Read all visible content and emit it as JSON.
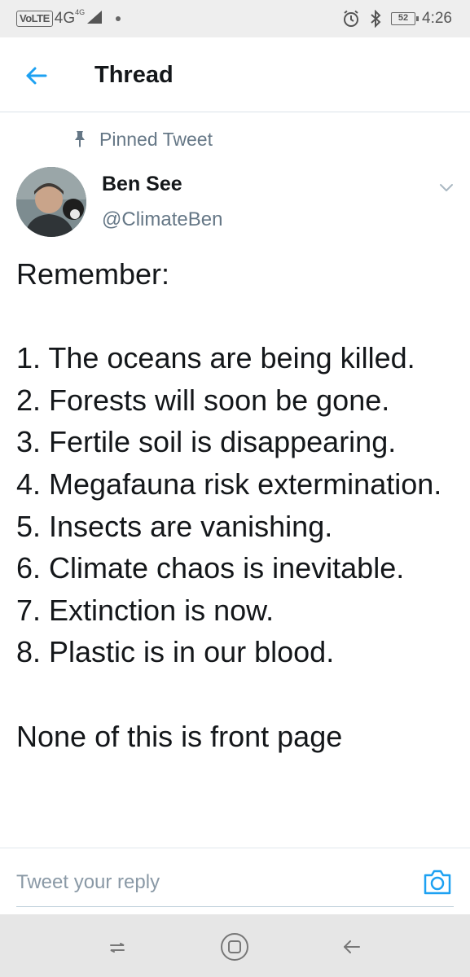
{
  "status_bar": {
    "volte": "VoLTE",
    "network": "4G",
    "network_sup": "4G",
    "battery": "52",
    "time": "4:26"
  },
  "header": {
    "title": "Thread"
  },
  "tweet": {
    "pinned_label": "Pinned Tweet",
    "author_name": "Ben See",
    "author_handle": "@ClimateBen",
    "text": "Remember:\n\n1. The oceans are being killed.\n2. Forests will soon be gone.\n3. Fertile soil is disappearing.\n4. Megafauna risk extermination.\n5. Insects are vanishing.\n6. Climate chaos is inevitable.\n7. Extinction is now.\n8. Plastic is in our blood.\n\nNone of this is front page"
  },
  "reply": {
    "placeholder": "Tweet your reply"
  },
  "icons": {
    "back": "back-arrow-icon",
    "pin": "pin-icon",
    "caret": "chevron-down-icon",
    "camera": "camera-icon",
    "alarm": "alarm-icon",
    "bluetooth": "bluetooth-icon"
  },
  "colors": {
    "accent": "#1da1f2",
    "text_primary": "#14171a",
    "text_secondary": "#657786",
    "status_bar_bg": "#eeeeee",
    "nav_bar_bg": "#e6e6e6"
  }
}
